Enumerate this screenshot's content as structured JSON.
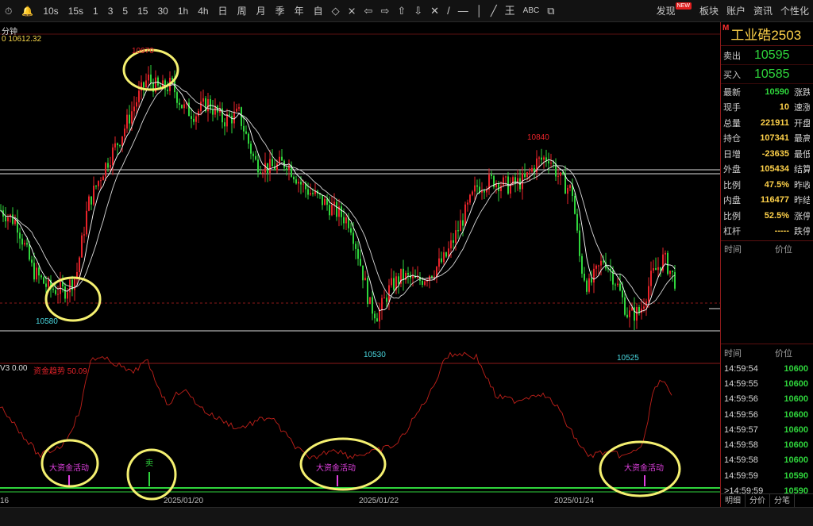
{
  "toolbar": {
    "items": [
      "⏱",
      "🔔",
      "10s",
      "15s",
      "1",
      "3",
      "5",
      "15",
      "30",
      "1h",
      "4h",
      "日",
      "周",
      "月",
      "季",
      "年",
      "自"
    ],
    "icons": [
      "◇",
      "⨯",
      "⇦",
      "⇨",
      "⇧",
      "⇩",
      "✕",
      "/",
      "—",
      "│",
      "╱",
      "王",
      "ABC",
      "⧉"
    ],
    "right": [
      "发现",
      "板块",
      "账户",
      "资讯",
      "个性化"
    ],
    "new_badge": "NEW"
  },
  "chart": {
    "top_left_label": "分钟",
    "ma_label": "0 10612.32",
    "price_labels": {
      "high1": "10970",
      "low1": "10580",
      "low2": "10530",
      "high2": "10840",
      "low3": "10525"
    },
    "indicator_label_a": "V3 0.00",
    "indicator_label_b": "资金趋势 50.09",
    "date_labels": [
      "16",
      "2025/01/20",
      "2025/01/22",
      "2025/01/24"
    ],
    "signals": [
      "大资金活动",
      "卖",
      "大资金活动",
      "大资金活动"
    ],
    "colors": {
      "up": "#e8232a",
      "down": "#2fd53c",
      "ma1": "#ffffff",
      "ma2": "#d8d8d8",
      "trend": "#c0201a",
      "signal": "#e040e0",
      "circle": "#f5f070"
    }
  },
  "chart_data": {
    "type": "candlestick",
    "title": "",
    "annotated_prices": [
      10970,
      10580,
      10530,
      10840,
      10525
    ],
    "ma_value": 10612.32,
    "indicator": {
      "name": "资金趋势",
      "value": 50.09,
      "v3": 0.0
    },
    "x_dates": [
      "2025/01/20",
      "2025/01/22",
      "2025/01/24"
    ]
  },
  "panel": {
    "m_badge": "M",
    "title": "工业硞2503",
    "sell_label": "卖出",
    "sell_price": "10595",
    "buy_label": "买入",
    "buy_price": "10585",
    "stats": [
      {
        "k": "最新",
        "v": "10590",
        "c": "#2fd53c",
        "k2": "涨跌"
      },
      {
        "k": "现手",
        "v": "10",
        "c": "#ffd24a",
        "k2": "速涨"
      },
      {
        "k": "总量",
        "v": "221911",
        "c": "#ffd24a",
        "k2": "开盘"
      },
      {
        "k": "持仓",
        "v": "107341",
        "c": "#ffd24a",
        "k2": "最高"
      },
      {
        "k": "日增",
        "v": "-23635",
        "c": "#ffd24a",
        "k2": "最低"
      },
      {
        "k": "外盘",
        "v": "105434",
        "c": "#ffd24a",
        "k2": "结算"
      },
      {
        "k": "比例",
        "v": "47.5%",
        "c": "#ffd24a",
        "k2": "昨收"
      },
      {
        "k": "内盘",
        "v": "116477",
        "c": "#ffd24a",
        "k2": "昨结"
      },
      {
        "k": "比例",
        "v": "52.5%",
        "c": "#ffd24a",
        "k2": "涨停"
      },
      {
        "k": "杠杆",
        "v": "-----",
        "c": "#ffd24a",
        "k2": "跌停"
      }
    ],
    "section1": {
      "time": "时间",
      "price": "价位"
    },
    "section2": {
      "time": "时间",
      "price": "价位"
    },
    "ticks": [
      {
        "t": "14:59:54",
        "p": "10600"
      },
      {
        "t": "14:59:55",
        "p": "10600"
      },
      {
        "t": "14:59:56",
        "p": "10600"
      },
      {
        "t": "14:59:56",
        "p": "10600"
      },
      {
        "t": "14:59:57",
        "p": "10600"
      },
      {
        "t": "14:59:58",
        "p": "10600"
      },
      {
        "t": "14:59:58",
        "p": "10600"
      },
      {
        "t": "14:59:59",
        "p": "10590"
      },
      {
        "t": ">14:59:59",
        "p": "10590"
      }
    ],
    "tabs": [
      "明细",
      "分价",
      "分笔"
    ]
  }
}
